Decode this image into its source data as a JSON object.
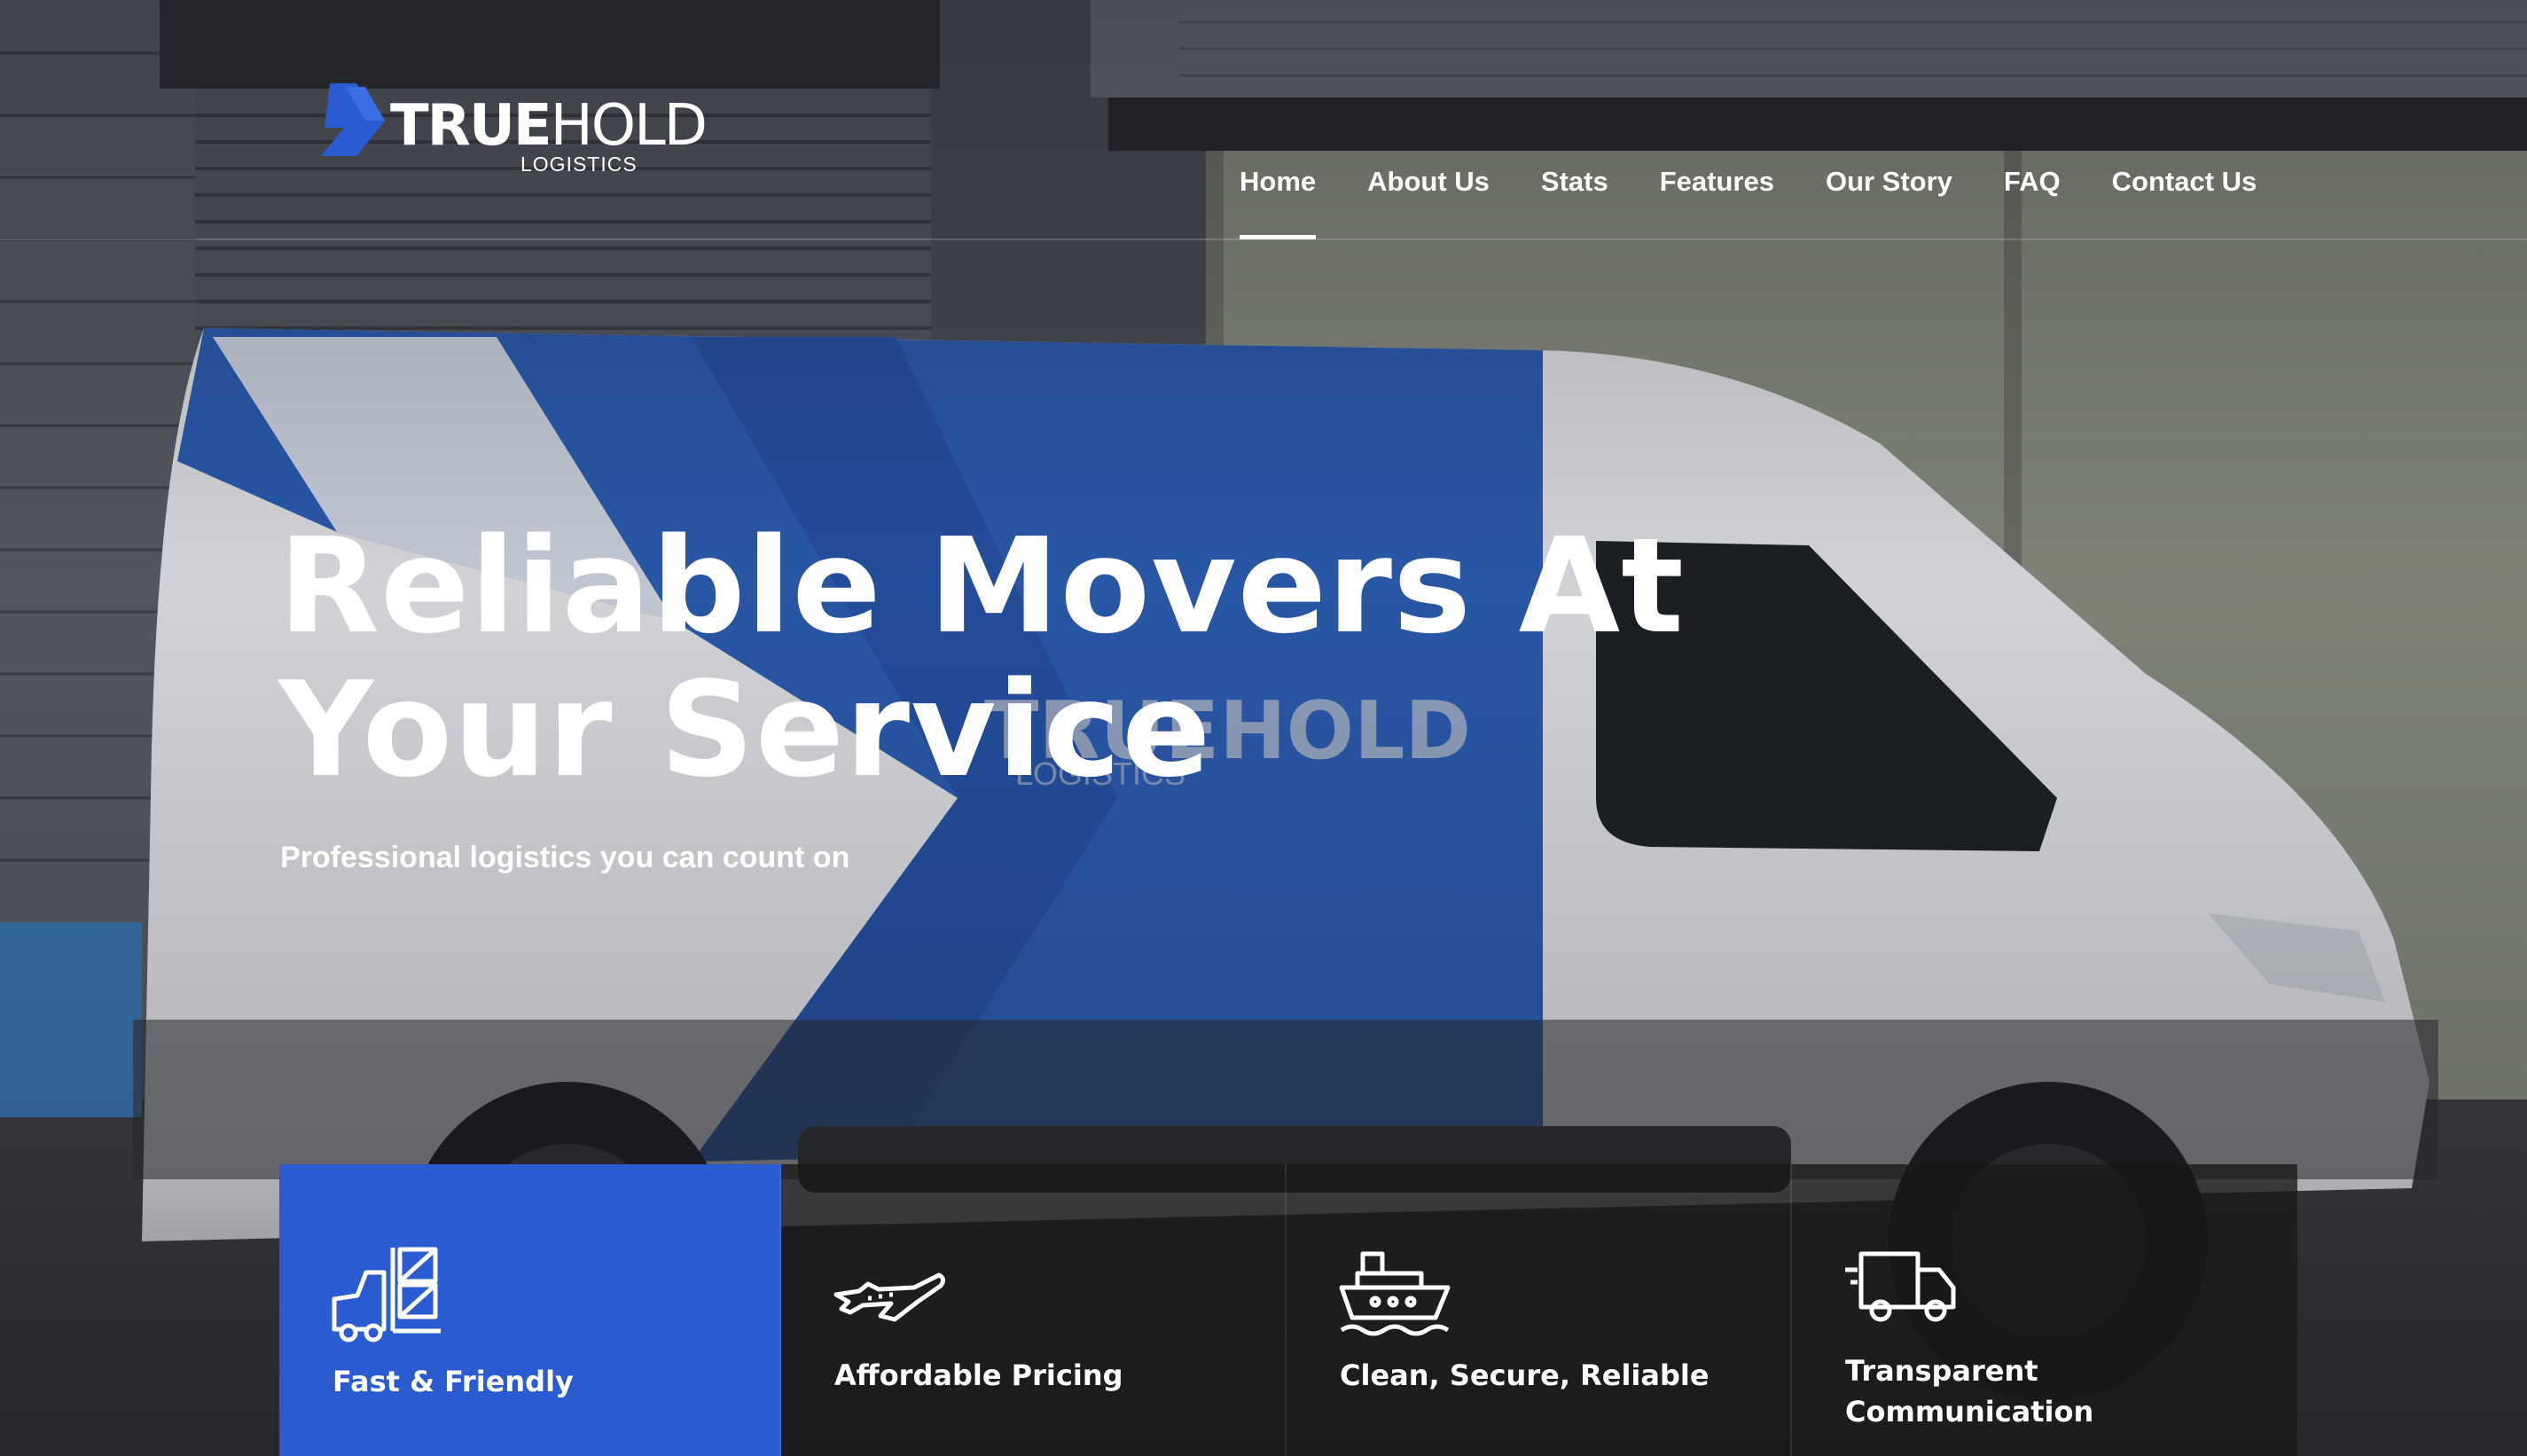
{
  "brand": {
    "name_bold": "TRUE",
    "name_light": "HOLD",
    "tagline": "LOGISTICS",
    "accent_color": "#2a5bd1",
    "logo_icon": "arrow-chevron-logo-icon"
  },
  "nav": {
    "items": [
      {
        "label": "Home",
        "active": true
      },
      {
        "label": "About Us",
        "active": false
      },
      {
        "label": "Stats",
        "active": false
      },
      {
        "label": "Features",
        "active": false
      },
      {
        "label": "Our Story",
        "active": false
      },
      {
        "label": "FAQ",
        "active": false
      },
      {
        "label": "Contact Us",
        "active": false
      }
    ]
  },
  "hero": {
    "title_line1": "Reliable Movers At",
    "title_line2": "Your Service",
    "subtitle": "Professional logistics you can count on"
  },
  "features": [
    {
      "label": "Fast & Friendly",
      "icon": "forklift-boxes-icon",
      "active": true
    },
    {
      "label": "Affordable Pricing",
      "icon": "airplane-icon",
      "active": false
    },
    {
      "label": "Clean, Secure, Reliable",
      "icon": "cargo-ship-icon",
      "active": false
    },
    {
      "label": "Transparent Communication",
      "icon": "delivery-truck-icon",
      "active": false
    }
  ]
}
